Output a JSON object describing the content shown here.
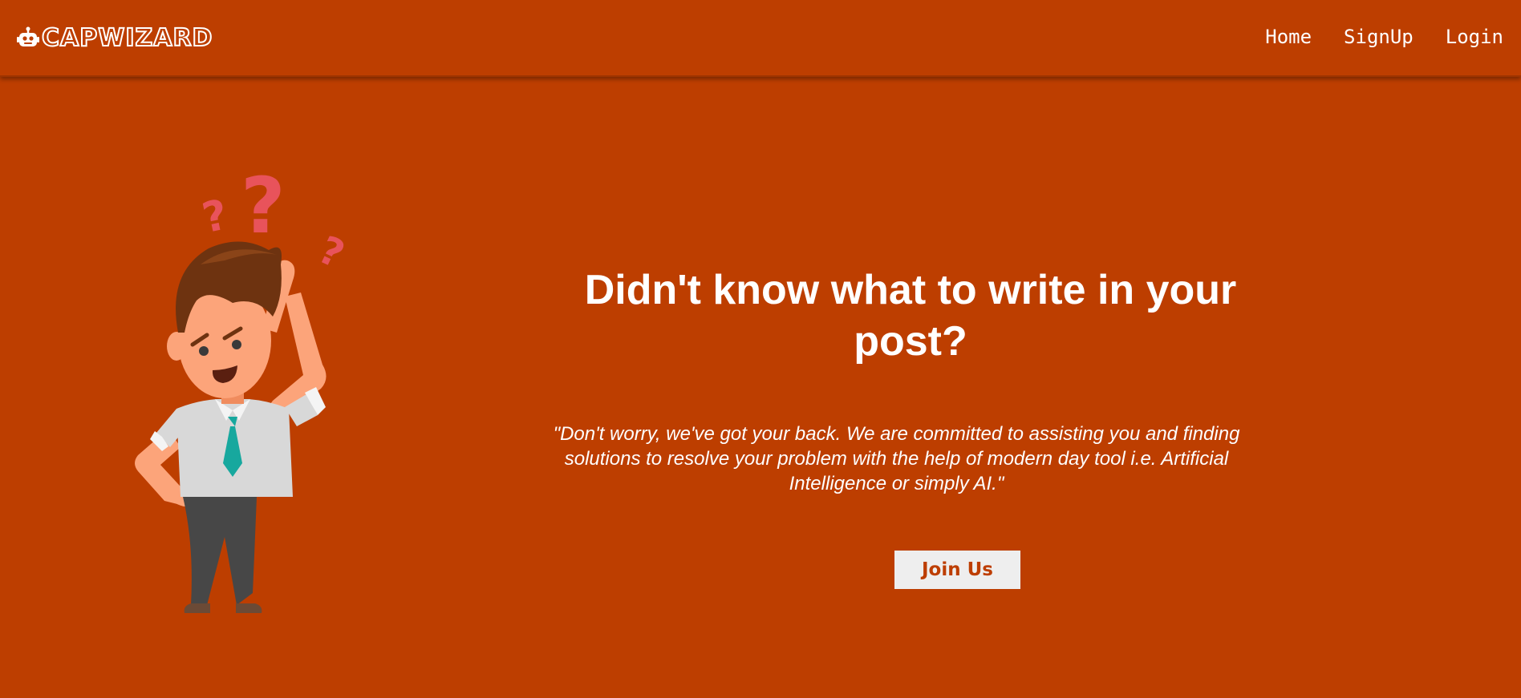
{
  "brand": {
    "name": "CAPWIZARD",
    "icon": "robot-icon"
  },
  "nav": {
    "items": [
      {
        "label": "Home"
      },
      {
        "label": "SignUp"
      },
      {
        "label": "Login"
      }
    ]
  },
  "hero": {
    "headline": "Didn't know what to write in your post?",
    "quote": "\"Don't worry, we've got your back. We are committed to assisting you and finding solutions to resolve your problem with the help of modern day tool i.e. Artificial Intelligence or simply AI.\"",
    "cta_label": "Join Us",
    "illustration": "confused-man-icon"
  },
  "colors": {
    "background": "#bd3e00",
    "text": "#ffffff",
    "button_bg": "#eeeeee",
    "accent_question_marks": "#e8535b",
    "tie": "#17a89e"
  }
}
